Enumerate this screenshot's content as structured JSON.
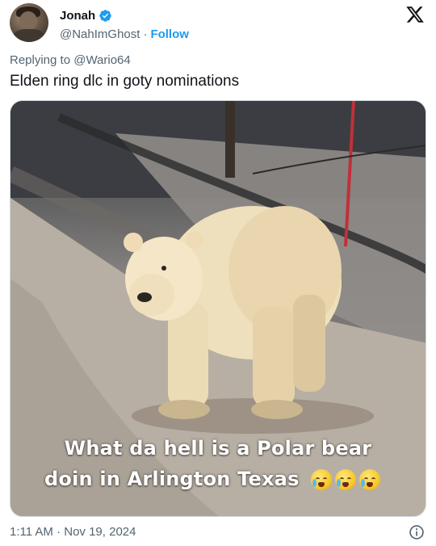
{
  "author": {
    "display_name": "Jonah",
    "handle": "@NahImGhost",
    "separator": "·",
    "follow_label": "Follow",
    "verified": true
  },
  "icons": {
    "verified": "verified-badge-icon",
    "platform_logo": "x-logo-icon",
    "info": "info-icon"
  },
  "reply": {
    "prefix": "Replying to",
    "mention": "@Wario64"
  },
  "tweet": {
    "text": "Elden ring dlc in goty nominations"
  },
  "media": {
    "caption_line1": "What da hell is a Polar bear",
    "caption_line2": "doin in Arlington Texas"
  },
  "footer": {
    "timestamp": "1:11 AM · Nov 19, 2024"
  },
  "colors": {
    "accent": "#1d9bf0",
    "text_primary": "#0f1419",
    "text_secondary": "#536471",
    "border": "#cfd9de"
  }
}
